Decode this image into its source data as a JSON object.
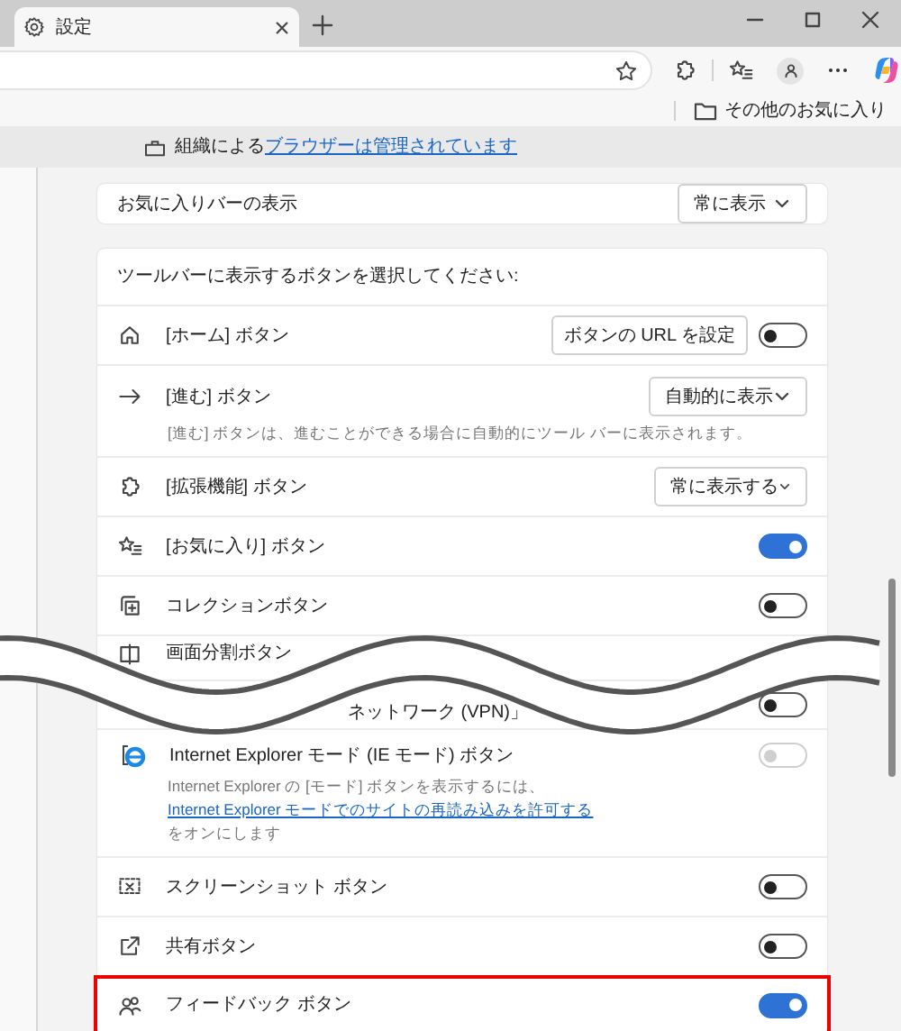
{
  "tab": {
    "title": "設定",
    "selected": true
  },
  "favorites_bar": {
    "label": "その他のお気に入り"
  },
  "managed_notice": {
    "text": "組織による",
    "link": "ブラウザーは管理されています"
  },
  "favorites_bar_setting": {
    "label": "お気に入りバーの表示",
    "dropdown": "常に表示"
  },
  "toolbar_section": {
    "heading": "ツールバーに表示するボタンを選択してください:",
    "rows": [
      {
        "kind": "toggle_button",
        "label": "[ホーム] ボタン",
        "button": "ボタンの URL を設定",
        "on": false,
        "disabled": false,
        "highlighted": false
      },
      {
        "kind": "dropdown",
        "label": "[進む] ボタン",
        "dropdown": "自動的に表示",
        "description": "[進む] ボタンは、進むことができる場合に自動的にツール バーに表示されます。",
        "highlighted": false
      },
      {
        "kind": "dropdown",
        "label": "[拡張機能] ボタン",
        "dropdown": "常に表示する",
        "highlighted": false
      },
      {
        "kind": "toggle",
        "label": "[お気に入り] ボタン",
        "on": true,
        "disabled": false,
        "highlighted": false
      },
      {
        "kind": "toggle",
        "label": "コレクションボタン",
        "on": false,
        "disabled": false,
        "highlighted": false
      },
      {
        "kind": "label",
        "label": "画面分割ボタン",
        "highlighted": false
      },
      {
        "kind": "toggle",
        "label": "ネットワーク (VPN)」",
        "on": false,
        "disabled": false,
        "highlighted": false
      },
      {
        "kind": "toggle",
        "label": "Internet Explorer モード (IE モード) ボタン",
        "on": false,
        "disabled": true,
        "description": "Internet Explorer の [モード] ボタンを表示するには、",
        "description_link": "Internet Explorer モードでのサイトの再読み込みを許可する",
        "description_after": "をオンにします",
        "highlighted": false
      },
      {
        "kind": "toggle",
        "label": "スクリーンショット ボタン",
        "on": false,
        "disabled": false,
        "highlighted": false
      },
      {
        "kind": "toggle",
        "label": "共有ボタン",
        "on": false,
        "disabled": false,
        "highlighted": false
      },
      {
        "kind": "toggle",
        "label": "フィードバック ボタン",
        "on": true,
        "disabled": false,
        "highlighted": true
      }
    ]
  }
}
